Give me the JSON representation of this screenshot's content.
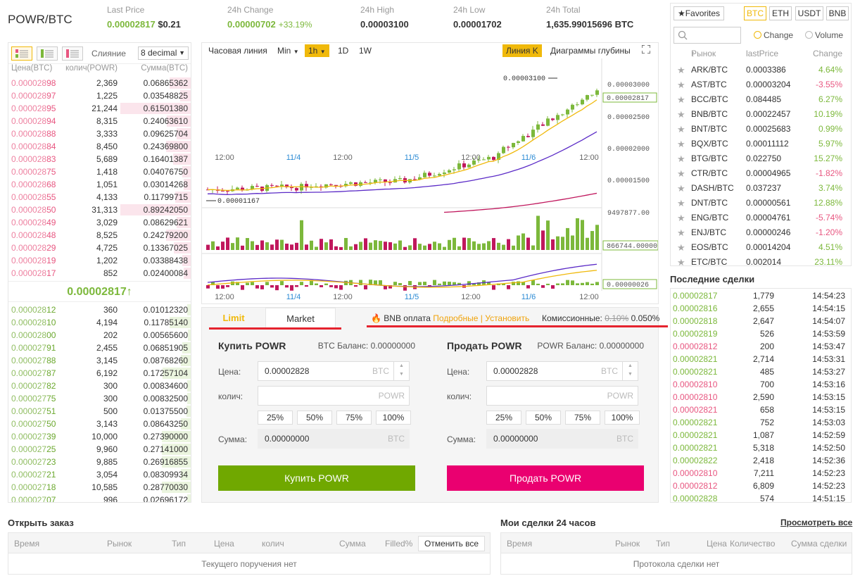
{
  "header": {
    "pair": "POWR/BTC",
    "stats": [
      {
        "label": "Last Price",
        "value": "0.00002817",
        "extra": "$0.21"
      },
      {
        "label": "24h Change",
        "value": "0.00000702",
        "extra": "+33.19%"
      },
      {
        "label": "24h High",
        "value": "0.00003100"
      },
      {
        "label": "24h Low",
        "value": "0.00001702"
      },
      {
        "label": "24h Total",
        "value": "1,635.99015696 BTC"
      }
    ]
  },
  "orderbook": {
    "merge_label": "Слияние",
    "merge_value": "8 decimal",
    "headers": {
      "price": "Цена(BTC)",
      "qty": "колич(POWR)",
      "sum": "Сумма(BTC)"
    },
    "sells": [
      {
        "p1": "0.000028",
        "p2": "98",
        "q": "2,369",
        "s": "0.06865362",
        "d": 0.3
      },
      {
        "p1": "0.000028",
        "p2": "97",
        "q": "1,225",
        "s": "0.03548825",
        "d": 0.15
      },
      {
        "p1": "0.000028",
        "p2": "95",
        "q": "21,244",
        "s": "0.61501380",
        "d": 1.0
      },
      {
        "p1": "0.000028",
        "p2": "94",
        "q": "8,315",
        "s": "0.24063610",
        "d": 0.34
      },
      {
        "p1": "0.000028",
        "p2": "88",
        "q": "3,333",
        "s": "0.09625704",
        "d": 0.2
      },
      {
        "p1": "0.000028",
        "p2": "84",
        "q": "8,450",
        "s": "0.24369800",
        "d": 0.35
      },
      {
        "p1": "0.000028",
        "p2": "83",
        "q": "5,689",
        "s": "0.16401387",
        "d": 0.25
      },
      {
        "p1": "0.000028",
        "p2": "75",
        "q": "1,418",
        "s": "0.04076750",
        "d": 0.12
      },
      {
        "p1": "0.000028",
        "p2": "68",
        "q": "1,051",
        "s": "0.03014268",
        "d": 0.1
      },
      {
        "p1": "0.000028",
        "p2": "55",
        "q": "4,133",
        "s": "0.11799715",
        "d": 0.22
      },
      {
        "p1": "0.000028",
        "p2": "50",
        "q": "31,313",
        "s": "0.89242050",
        "d": 1.0
      },
      {
        "p1": "0.000028",
        "p2": "49",
        "q": "3,029",
        "s": "0.08629621",
        "d": 0.2
      },
      {
        "p1": "0.000028",
        "p2": "48",
        "q": "8,525",
        "s": "0.24279200",
        "d": 0.35
      },
      {
        "p1": "0.000028",
        "p2": "29",
        "q": "4,725",
        "s": "0.13367025",
        "d": 0.24
      },
      {
        "p1": "0.000028",
        "p2": "19",
        "q": "1,202",
        "s": "0.03388438",
        "d": 0.12
      },
      {
        "p1": "0.000028",
        "p2": "17",
        "q": "852",
        "s": "0.02400084",
        "d": 0.1
      }
    ],
    "last_price": "0.00002817",
    "buys": [
      {
        "p1": "0.000028",
        "p2": "12",
        "q": "360",
        "s": "0.01012320",
        "d": 0.05
      },
      {
        "p1": "0.000028",
        "p2": "10",
        "q": "4,194",
        "s": "0.11785140",
        "d": 0.3
      },
      {
        "p1": "0.000028",
        "p2": "00",
        "q": "202",
        "s": "0.00565600",
        "d": 0.04
      },
      {
        "p1": "0.000027",
        "p2": "91",
        "q": "2,455",
        "s": "0.06851905",
        "d": 0.12
      },
      {
        "p1": "0.000027",
        "p2": "88",
        "q": "3,145",
        "s": "0.08768260",
        "d": 0.14
      },
      {
        "p1": "0.000027",
        "p2": "87",
        "q": "6,192",
        "s": "0.17257104",
        "d": 0.4
      },
      {
        "p1": "0.000027",
        "p2": "82",
        "q": "300",
        "s": "0.00834600",
        "d": 0.05
      },
      {
        "p1": "0.000027",
        "p2": "75",
        "q": "300",
        "s": "0.00832500",
        "d": 0.05
      },
      {
        "p1": "0.000027",
        "p2": "51",
        "q": "500",
        "s": "0.01375500",
        "d": 0.06
      },
      {
        "p1": "0.000027",
        "p2": "50",
        "q": "3,143",
        "s": "0.08643250",
        "d": 0.14
      },
      {
        "p1": "0.000027",
        "p2": "39",
        "q": "10,000",
        "s": "0.27390000",
        "d": 0.41
      },
      {
        "p1": "0.000027",
        "p2": "25",
        "q": "9,960",
        "s": "0.27141000",
        "d": 0.41
      },
      {
        "p1": "0.000027",
        "p2": "23",
        "q": "9,885",
        "s": "0.26916855",
        "d": 0.41
      },
      {
        "p1": "0.000027",
        "p2": "21",
        "q": "3,054",
        "s": "0.08309934",
        "d": 0.14
      },
      {
        "p1": "0.000027",
        "p2": "18",
        "q": "10,585",
        "s": "0.28770030",
        "d": 0.41
      },
      {
        "p1": "0.000027",
        "p2": "07",
        "q": "996",
        "s": "0.02696172",
        "d": 0.05
      }
    ]
  },
  "chart": {
    "toolbar": {
      "line": "Часовая линия",
      "min": "Min",
      "h1": "1h",
      "d1": "1D",
      "w1": "1W",
      "kline": "Линия K",
      "depth": "Диаграммы глубины"
    },
    "price_ticks": [
      "0.00003000",
      "0.00002500",
      "0.00002000",
      "0.00001500"
    ],
    "current_label": "0.00002817",
    "high_label": "0.00003100",
    "low_label": "0.00001167",
    "volume_max": "9497877.00",
    "volume_current": "866744.00000",
    "macd_current": "0.00000026",
    "time_labels": [
      "12:00",
      "11/4",
      "12:00",
      "11/5",
      "12:00",
      "11/6",
      "12:00"
    ]
  },
  "trade": {
    "tab_limit": "Limit",
    "tab_market": "Market",
    "bnb_label": "BNB оплата",
    "bnb_links": "Подробные | Установить",
    "fee_label": "Комиссионные:",
    "fee_old": "0.10%",
    "fee_new": "0.050%",
    "buy": {
      "title": "Купить POWR",
      "balance": "BTC Баланс: 0.00000000",
      "price_label": "Цена:",
      "price": "0.00002828",
      "price_unit": "BTC",
      "qty_label": "колич:",
      "qty_unit": "POWR",
      "sum_label": "Сумма:",
      "sum": "0.00000000",
      "sum_unit": "BTC",
      "button": "Купить POWR"
    },
    "sell": {
      "title": "Продать POWR",
      "balance": "POWR Баланс: 0.00000000",
      "price_label": "Цена:",
      "price": "0.00002828",
      "price_unit": "BTC",
      "qty_label": "колич:",
      "qty_unit": "POWR",
      "sum_label": "Сумма:",
      "sum": "0.00000000",
      "sum_unit": "BTC",
      "button": "Продать POWR"
    },
    "percents": [
      "25%",
      "50%",
      "75%",
      "100%"
    ]
  },
  "market": {
    "favorites": "Favorites",
    "tabs": [
      "BTC",
      "ETH",
      "USDT",
      "BNB"
    ],
    "radio_change": "Change",
    "radio_volume": "Volume",
    "headers": {
      "market": "Рынок",
      "price": "lastPrice",
      "change": "Change"
    },
    "rows": [
      {
        "sym": "ARK/BTC",
        "price": "0.0003386",
        "chg": "4.64%",
        "dir": "up"
      },
      {
        "sym": "AST/BTC",
        "price": "0.00003204",
        "chg": "-3.55%",
        "dir": "down"
      },
      {
        "sym": "BCC/BTC",
        "price": "0.084485",
        "chg": "6.27%",
        "dir": "up"
      },
      {
        "sym": "BNB/BTC",
        "price": "0.00022457",
        "chg": "10.19%",
        "dir": "up"
      },
      {
        "sym": "BNT/BTC",
        "price": "0.00025683",
        "chg": "0.99%",
        "dir": "up"
      },
      {
        "sym": "BQX/BTC",
        "price": "0.00011112",
        "chg": "5.97%",
        "dir": "up"
      },
      {
        "sym": "BTG/BTC",
        "price": "0.022750",
        "chg": "15.27%",
        "dir": "up"
      },
      {
        "sym": "CTR/BTC",
        "price": "0.00004965",
        "chg": "-1.82%",
        "dir": "down"
      },
      {
        "sym": "DASH/BTC",
        "price": "0.037237",
        "chg": "3.74%",
        "dir": "up"
      },
      {
        "sym": "DNT/BTC",
        "price": "0.00000561",
        "chg": "12.88%",
        "dir": "up"
      },
      {
        "sym": "ENG/BTC",
        "price": "0.00004761",
        "chg": "-5.74%",
        "dir": "down"
      },
      {
        "sym": "ENJ/BTC",
        "price": "0.00000246",
        "chg": "-1.20%",
        "dir": "down"
      },
      {
        "sym": "EOS/BTC",
        "price": "0.00014204",
        "chg": "4.51%",
        "dir": "up"
      },
      {
        "sym": "ETC/BTC",
        "price": "0.002014",
        "chg": "23.11%",
        "dir": "up"
      }
    ]
  },
  "trades": {
    "title": "Последние сделки",
    "rows": [
      {
        "p": "0.00002817",
        "q": "1,779",
        "t": "14:54:23",
        "dir": "up"
      },
      {
        "p": "0.00002816",
        "q": "2,655",
        "t": "14:54:15",
        "dir": "up"
      },
      {
        "p": "0.00002818",
        "q": "2,647",
        "t": "14:54:07",
        "dir": "up"
      },
      {
        "p": "0.00002819",
        "q": "526",
        "t": "14:53:59",
        "dir": "up"
      },
      {
        "p": "0.00002812",
        "q": "200",
        "t": "14:53:47",
        "dir": "down"
      },
      {
        "p": "0.00002821",
        "q": "2,714",
        "t": "14:53:31",
        "dir": "up"
      },
      {
        "p": "0.00002821",
        "q": "485",
        "t": "14:53:27",
        "dir": "up"
      },
      {
        "p": "0.00002810",
        "q": "700",
        "t": "14:53:16",
        "dir": "down"
      },
      {
        "p": "0.00002810",
        "q": "2,590",
        "t": "14:53:15",
        "dir": "down"
      },
      {
        "p": "0.00002821",
        "q": "658",
        "t": "14:53:15",
        "dir": "down"
      },
      {
        "p": "0.00002821",
        "q": "752",
        "t": "14:53:03",
        "dir": "up"
      },
      {
        "p": "0.00002821",
        "q": "1,087",
        "t": "14:52:59",
        "dir": "up"
      },
      {
        "p": "0.00002821",
        "q": "5,318",
        "t": "14:52:50",
        "dir": "up"
      },
      {
        "p": "0.00002822",
        "q": "2,418",
        "t": "14:52:36",
        "dir": "up"
      },
      {
        "p": "0.00002810",
        "q": "7,211",
        "t": "14:52:23",
        "dir": "down"
      },
      {
        "p": "0.00002812",
        "q": "6,809",
        "t": "14:52:23",
        "dir": "down"
      },
      {
        "p": "0.00002828",
        "q": "574",
        "t": "14:51:15",
        "dir": "up"
      }
    ]
  },
  "open_orders": {
    "title": "Открыть заказ",
    "headers": [
      "Время",
      "Рынок",
      "Тип",
      "Цена",
      "колич",
      "Сумма",
      "Filled%"
    ],
    "cancel_all": "Отменить все",
    "empty": "Текущего поручения нет"
  },
  "my_trades": {
    "title": "Мои сделки 24 часов",
    "view_all": "Просмотреть все",
    "headers": [
      "Время",
      "Рынок",
      "Тип",
      "Цена",
      "Количество",
      "Сумма сделки"
    ],
    "empty": "Протокола сделки нет"
  },
  "colors": {
    "accent": "#f0b90b",
    "up": "#7cb83b",
    "down": "#e85680",
    "buy_button": "#70a800",
    "sell_button": "#ea0070",
    "underline": "#e5232e"
  }
}
